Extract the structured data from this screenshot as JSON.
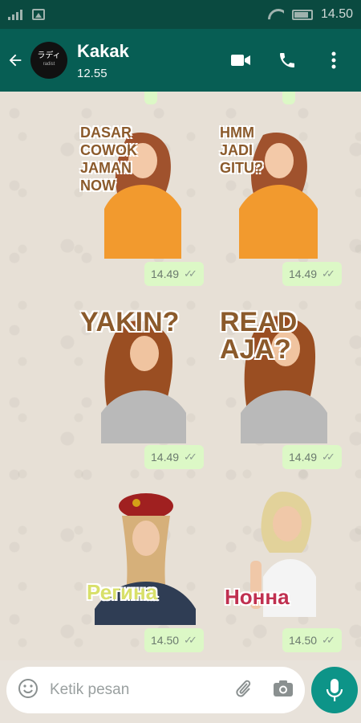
{
  "status_bar": {
    "time": "14.50"
  },
  "header": {
    "avatar_text": "ラディ",
    "avatar_sub": "radist",
    "contact_name": "Kakak",
    "last_seen": "12.55"
  },
  "messages": [
    {
      "text_lines": [
        "DASAR",
        "COWOK",
        "JAMAN",
        "NOW"
      ],
      "time": "14.49"
    },
    {
      "text_lines": [
        "HMM",
        "JADI",
        "GITU?"
      ],
      "time": "14.49"
    },
    {
      "text_lines": [
        "YAKIN?"
      ],
      "time": "14.49"
    },
    {
      "text_lines": [
        "READ",
        "AJA?"
      ],
      "time": "14.49"
    },
    {
      "text_lines": [
        "Регина"
      ],
      "time": "14.50"
    },
    {
      "text_lines": [
        "Нонна"
      ],
      "time": "14.50"
    }
  ],
  "input": {
    "placeholder": "Ketik pesan"
  },
  "colors": {
    "appbar": "#075e54",
    "bubble": "#dcf8c6",
    "fab": "#0d9488"
  },
  "icons": [
    "back-arrow-icon",
    "video-call-icon",
    "phone-icon",
    "more-vert-icon",
    "emoji-icon",
    "attach-icon",
    "camera-icon",
    "mic-icon"
  ]
}
